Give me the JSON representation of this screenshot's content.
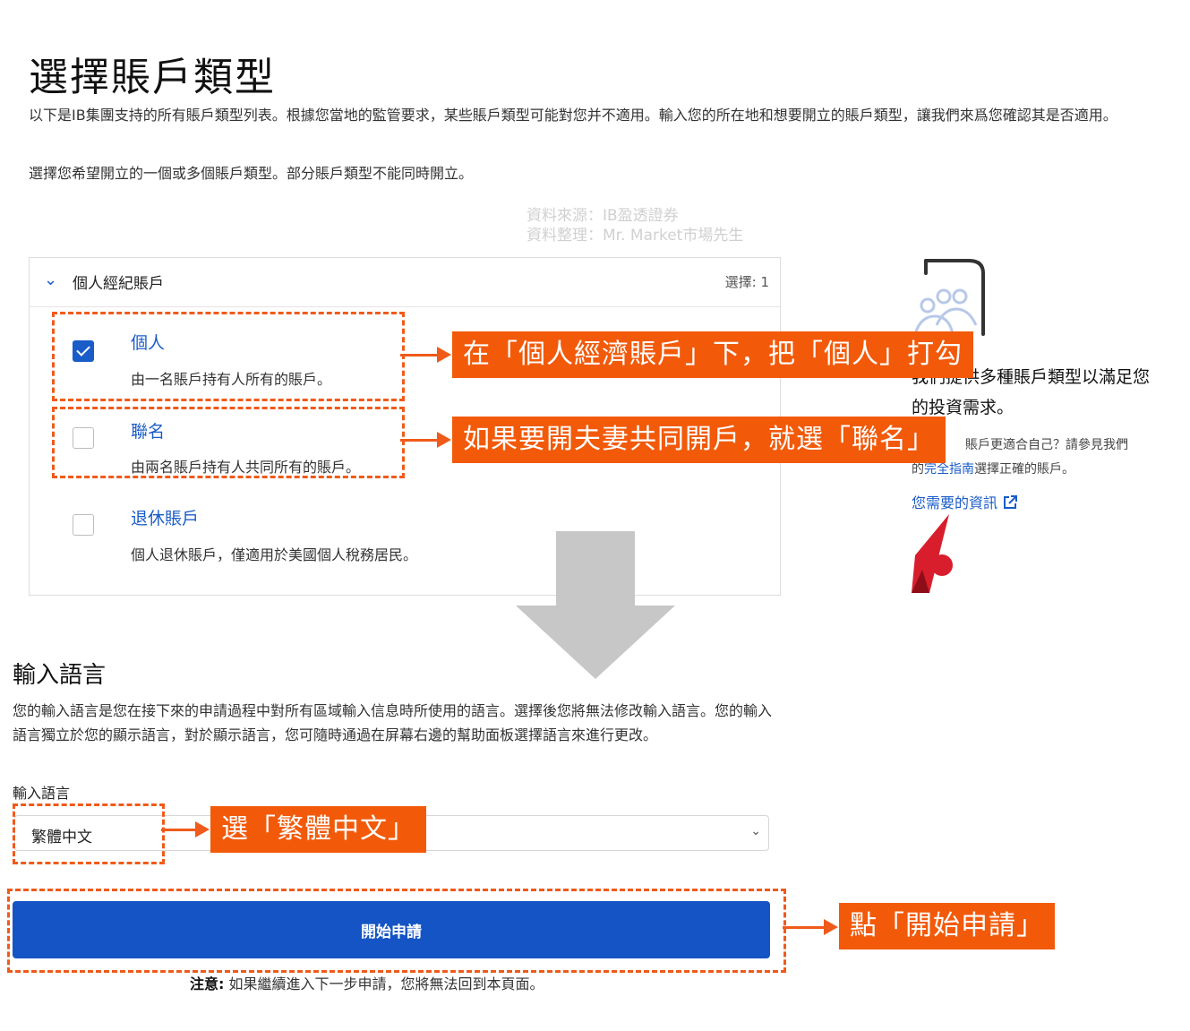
{
  "page": {
    "title": "選擇賬戶類型",
    "intro1": "以下是IB集團支持的所有賬戶類型列表。根據您當地的監管要求，某些賬戶類型可能對您并不適用。輸入您的所在地和想要開立的賬戶類型，讓我們來爲您確認其是否適用。",
    "intro2": "選擇您希望開立的一個或多個賬戶類型。部分賬戶類型不能同時開立。",
    "watermark_line1": "資料來源：IB盈透證券",
    "watermark_line2": "資料整理：Mr. Market市場先生"
  },
  "account_group": {
    "label": "個人經紀賬戶",
    "count": "選擇: 1",
    "options": [
      {
        "title": "個人",
        "desc": "由一名賬戶持有人所有的賬戶。",
        "checked": true
      },
      {
        "title": "聯名",
        "desc": "由兩名賬戶持有人共同所有的賬戶。",
        "checked": false
      },
      {
        "title": "退休賬戶",
        "desc": "個人退休賬戶，僅適用於美國個人稅務居民。",
        "checked": false
      }
    ]
  },
  "sidebar": {
    "line1_visible": "我們提供多種賬戶類型以滿足您",
    "line2": "的投資需求。",
    "small1": "賬戶更適合自己？請參見我們",
    "small2_prefix": "的",
    "small2_link": "完全指南",
    "small2_suffix": "選擇正確的賬戶。",
    "info_link": "您需要的資訊"
  },
  "annotations": {
    "individual": "在「個人經濟賬戶」下，把「個人」打勾",
    "joint": "如果要開夫妻共同開戶，就選「聯名」",
    "language": "選「繁體中文」",
    "start": "點「開始申請」"
  },
  "language": {
    "heading": "輸入語言",
    "description": "您的輸入語言是您在接下來的申請過程中對所有區域輸入信息時所使用的語言。選擇後您將無法修改輸入語言。您的輸入語言獨立於您的顯示語言，對於顯示語言，您可隨時通過在屏幕右邊的幫助面板選擇語言來進行更改。",
    "field_label": "輸入語言",
    "selected": "繁體中文"
  },
  "actions": {
    "start_label": "開始申請",
    "note_label": "注意:",
    "note_text": " 如果繼續進入下一步申請，您將無法回到本頁面。"
  },
  "colors": {
    "accent_blue": "#1454c4",
    "annotation_orange": "#f25a0a",
    "logo_red": "#d81e2c"
  }
}
